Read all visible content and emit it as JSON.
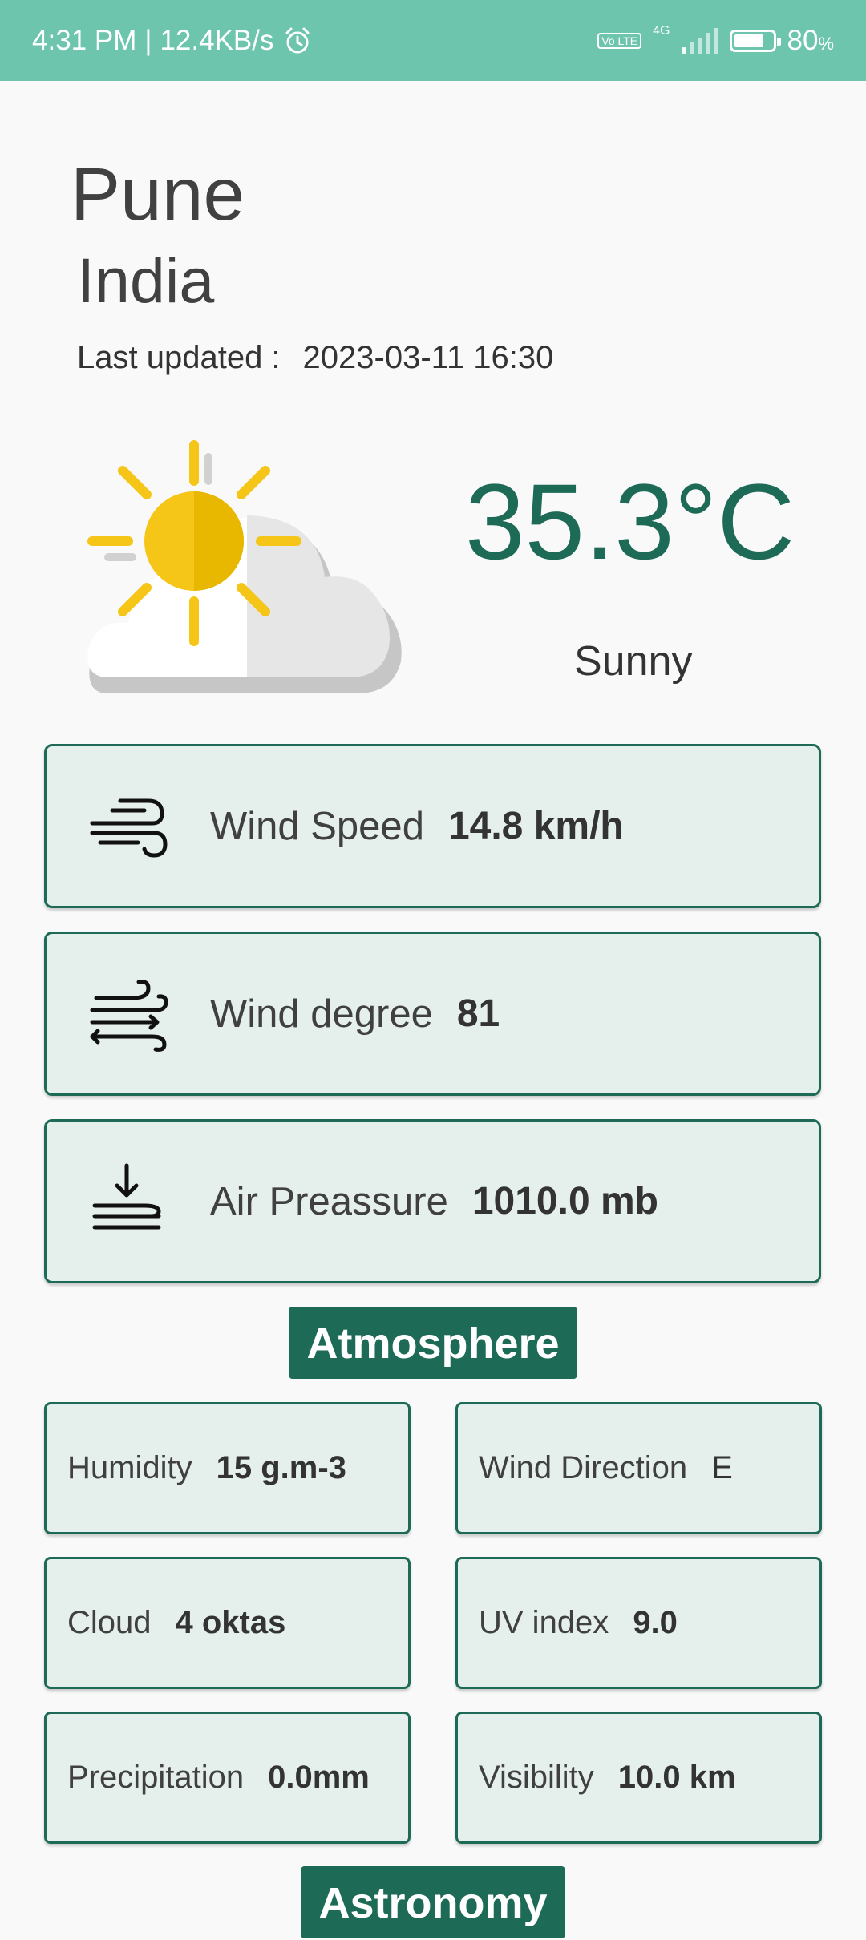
{
  "status_bar": {
    "time": "4:31 PM",
    "separator": "|",
    "speed": "12.4KB/s",
    "volte": "Vo LTE",
    "network": "4G",
    "battery_level": 0.8,
    "battery": "80",
    "battery_unit": "%"
  },
  "location": {
    "city": "Pune",
    "country": "India",
    "updated_label": "Last updated :",
    "updated_value": "2023-03-11 16:30"
  },
  "current": {
    "temperature": "35.3°C",
    "condition": "Sunny",
    "icon": "sun-behind-cloud-icon"
  },
  "metrics": [
    {
      "label": "Wind Speed",
      "value": "14.8 km/h",
      "icon": "wind-icon"
    },
    {
      "label": "Wind degree",
      "value": "81",
      "icon": "wind-direction-icon"
    },
    {
      "label": "Air Preassure",
      "value": "1010.0 mb",
      "icon": "pressure-icon"
    }
  ],
  "atmosphere": {
    "title": "Atmosphere",
    "items": [
      {
        "label": "Humidity",
        "value": "15 g.m-3"
      },
      {
        "label": "Wind Direction",
        "value": "E"
      },
      {
        "label": "Cloud",
        "value": "4 oktas"
      },
      {
        "label": "UV index",
        "value": "9.0"
      },
      {
        "label": "Precipitation",
        "value": "0.0mm"
      },
      {
        "label": "Visibility",
        "value": "10.0 km"
      }
    ]
  },
  "astronomy": {
    "title": "Astronomy"
  },
  "colors": {
    "status_bar": "#6dc5ae",
    "accent": "#1d6a56",
    "card_bg": "#e5f0ec",
    "sun": "#f5c518"
  }
}
